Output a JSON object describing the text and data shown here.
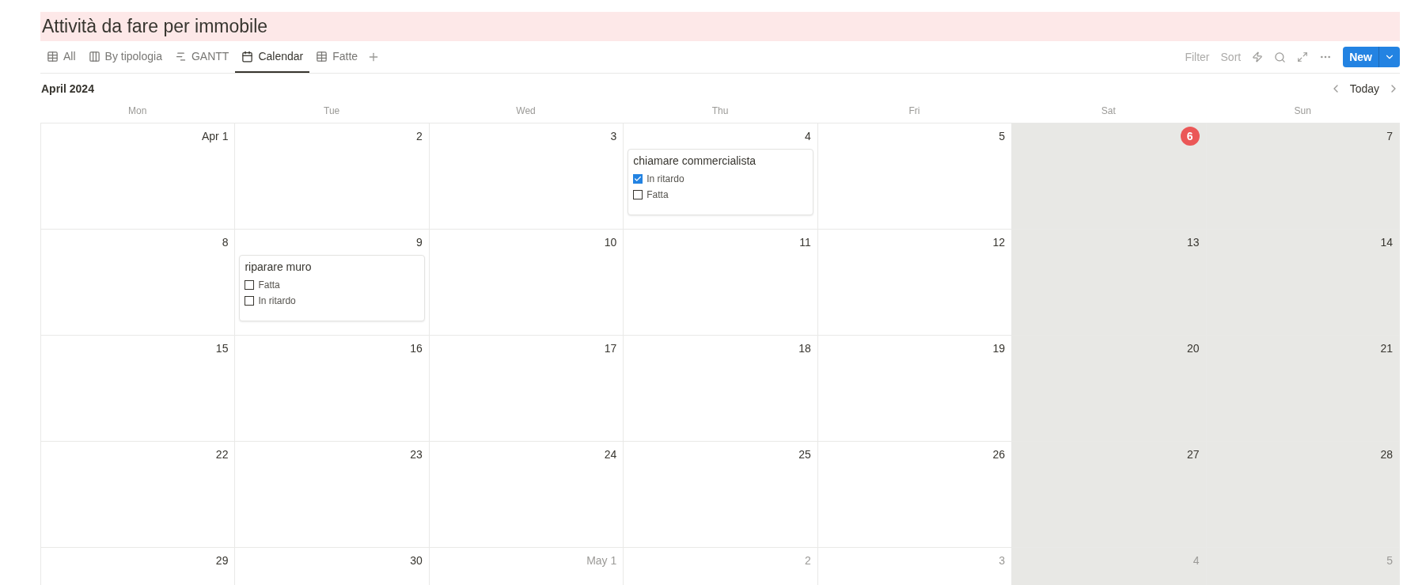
{
  "title": "Attività da fare per immobile",
  "tabs": [
    {
      "label": "All",
      "kind": "table",
      "selected": false
    },
    {
      "label": "By tipologia",
      "kind": "board",
      "selected": false
    },
    {
      "label": "GANTT",
      "kind": "timeline",
      "selected": false
    },
    {
      "label": "Calendar",
      "kind": "calendar",
      "selected": true
    },
    {
      "label": "Fatte",
      "kind": "table",
      "selected": false
    }
  ],
  "toolbar": {
    "filter": "Filter",
    "sort": "Sort",
    "new_button": "New"
  },
  "calendar": {
    "month": "April 2024",
    "today_button": "Today",
    "weekdays": [
      {
        "label": "Mon",
        "weekend": false
      },
      {
        "label": "Tue",
        "weekend": false
      },
      {
        "label": "Wed",
        "weekend": false
      },
      {
        "label": "Thu",
        "weekend": false
      },
      {
        "label": "Fri",
        "weekend": false
      },
      {
        "label": "Sat",
        "weekend": true
      },
      {
        "label": "Sun",
        "weekend": true
      }
    ],
    "weeks": [
      [
        {
          "label": "Apr 1",
          "today": false,
          "outside": false
        },
        {
          "label": "2",
          "today": false,
          "outside": false
        },
        {
          "label": "3",
          "today": false,
          "outside": false
        },
        {
          "label": "4",
          "today": false,
          "outside": false,
          "events": [
            {
              "title": "chiamare commercialista",
              "properties": [
                {
                  "label": "In ritardo",
                  "checked": true
                },
                {
                  "label": "Fatta",
                  "checked": false
                }
              ]
            }
          ]
        },
        {
          "label": "5",
          "today": false,
          "outside": false
        },
        {
          "label": "6",
          "today": true,
          "outside": false
        },
        {
          "label": "7",
          "today": false,
          "outside": false
        }
      ],
      [
        {
          "label": "8",
          "today": false,
          "outside": false
        },
        {
          "label": "9",
          "today": false,
          "outside": false,
          "events": [
            {
              "title": "riparare muro",
              "properties": [
                {
                  "label": "Fatta",
                  "checked": false
                },
                {
                  "label": "In ritardo",
                  "checked": false
                }
              ]
            }
          ]
        },
        {
          "label": "10",
          "today": false,
          "outside": false
        },
        {
          "label": "11",
          "today": false,
          "outside": false
        },
        {
          "label": "12",
          "today": false,
          "outside": false
        },
        {
          "label": "13",
          "today": false,
          "outside": false
        },
        {
          "label": "14",
          "today": false,
          "outside": false
        }
      ],
      [
        {
          "label": "15",
          "today": false,
          "outside": false
        },
        {
          "label": "16",
          "today": false,
          "outside": false
        },
        {
          "label": "17",
          "today": false,
          "outside": false
        },
        {
          "label": "18",
          "today": false,
          "outside": false
        },
        {
          "label": "19",
          "today": false,
          "outside": false
        },
        {
          "label": "20",
          "today": false,
          "outside": false
        },
        {
          "label": "21",
          "today": false,
          "outside": false
        }
      ],
      [
        {
          "label": "22",
          "today": false,
          "outside": false
        },
        {
          "label": "23",
          "today": false,
          "outside": false
        },
        {
          "label": "24",
          "today": false,
          "outside": false
        },
        {
          "label": "25",
          "today": false,
          "outside": false
        },
        {
          "label": "26",
          "today": false,
          "outside": false
        },
        {
          "label": "27",
          "today": false,
          "outside": false
        },
        {
          "label": "28",
          "today": false,
          "outside": false
        }
      ],
      [
        {
          "label": "29",
          "today": false,
          "outside": false
        },
        {
          "label": "30",
          "today": false,
          "outside": false
        },
        {
          "label": "May 1",
          "today": false,
          "outside": true
        },
        {
          "label": "2",
          "today": false,
          "outside": true
        },
        {
          "label": "3",
          "today": false,
          "outside": true
        },
        {
          "label": "4",
          "today": false,
          "outside": true
        },
        {
          "label": "5",
          "today": false,
          "outside": true
        }
      ]
    ]
  }
}
